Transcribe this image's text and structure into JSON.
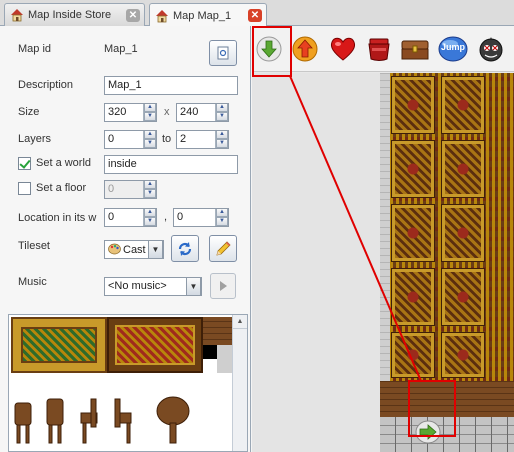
{
  "tabs": [
    {
      "label": "Map Inside Store",
      "active": false
    },
    {
      "label": "Map Map_1",
      "active": true
    }
  ],
  "properties": {
    "map_id_label": "Map id",
    "map_id_value": "Map_1",
    "description_label": "Description",
    "description_value": "Map_1",
    "size_label": "Size",
    "size_width": "320",
    "size_separator": "x",
    "size_height": "240",
    "layers_label": "Layers",
    "layers_from": "0",
    "layers_to_label": "to",
    "layers_to": "2",
    "world_checkbox_label": "Set a world",
    "world_checked": true,
    "world_value": "inside",
    "floor_checkbox_label": "Set a floor",
    "floor_checked": false,
    "floor_value": "0",
    "location_label": "Location in its w",
    "location_x": "0",
    "location_separator": ",",
    "location_y": "0",
    "tileset_label": "Tileset",
    "tileset_value": "Cast",
    "music_label": "Music",
    "music_value": "<No music>"
  },
  "toolbar": {
    "items": [
      {
        "name": "arrow-down-icon",
        "label": ""
      },
      {
        "name": "arrow-up-icon",
        "label": ""
      },
      {
        "name": "heart-icon",
        "label": ""
      },
      {
        "name": "pot-icon",
        "label": ""
      },
      {
        "name": "chest-icon",
        "label": ""
      },
      {
        "name": "jump-icon",
        "label": "Jump"
      },
      {
        "name": "enemy-icon",
        "label": ""
      }
    ]
  },
  "colors": {
    "highlight": "#e00000",
    "tab_close_active": "#d84128",
    "panel_border": "#9aa7b5"
  }
}
